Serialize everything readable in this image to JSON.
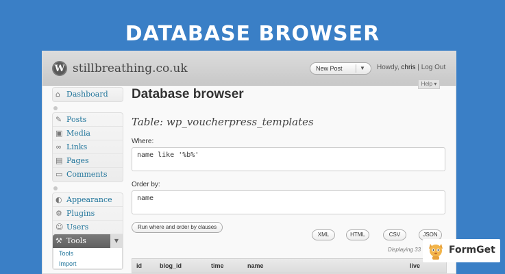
{
  "banner": {
    "title": "DATABASE BROWSER"
  },
  "header": {
    "site_title": "stillbreathing.co.uk",
    "new_post": "New Post",
    "howdy_prefix": "Howdy,",
    "username": "chris",
    "logout": "Log Out",
    "help": "Help"
  },
  "sidebar": {
    "dashboard": "Dashboard",
    "group1": [
      "Posts",
      "Media",
      "Links",
      "Pages",
      "Comments"
    ],
    "group2": [
      "Appearance",
      "Plugins",
      "Users"
    ],
    "tools": "Tools",
    "submenu": [
      "Tools",
      "Import"
    ]
  },
  "main": {
    "page_title": "Database browser",
    "table_heading": "Table: wp_voucherpress_templates",
    "where_label": "Where:",
    "where_value": "name like '%b%'",
    "order_label": "Order by:",
    "order_value": "name",
    "run_button": "Run where and order by clauses",
    "exports": [
      "XML",
      "HTML",
      "CSV",
      "JSON"
    ],
    "displaying": "Displaying 33",
    "columns": [
      "id",
      "blog_id",
      "time",
      "name",
      "live"
    ]
  },
  "badge": {
    "text": "FormGet"
  }
}
